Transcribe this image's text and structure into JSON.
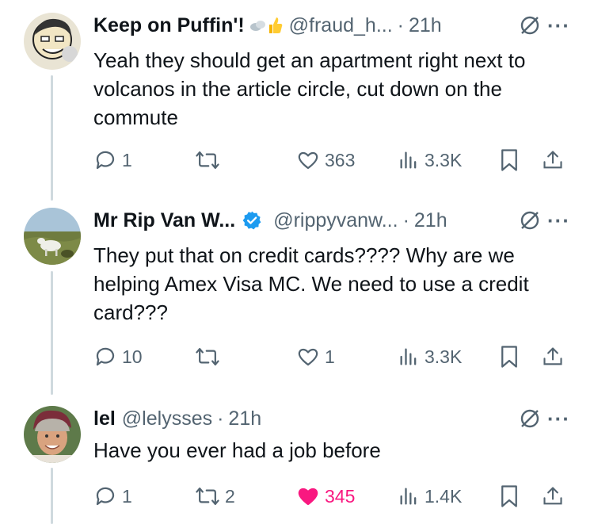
{
  "tweets": [
    {
      "name": "Keep on Puffin'!",
      "handle": "@fraud_h...",
      "time": "21h",
      "text": "Yeah they should get an apartment right next to volcanos in the article circle, cut down on the commute",
      "replies": "1",
      "reposts": "",
      "likes": "363",
      "views": "3.3K",
      "liked": false,
      "avatar_icon": "cartoon-face-avatar",
      "badges": [
        "cloud-emoji",
        "thumbs-up-emoji"
      ]
    },
    {
      "name": "Mr Rip Van W...",
      "handle": "@rippyvanw...",
      "time": "21h",
      "text": "They put that on credit cards???? Why are we helping Amex Visa MC. We need to use a credit card???",
      "replies": "10",
      "reposts": "",
      "likes": "1",
      "views": "3.3K",
      "liked": false,
      "avatar_icon": "goat-field-avatar",
      "badges": [
        "verified-badge"
      ]
    },
    {
      "name": "lel",
      "handle": "@lelysses",
      "time": "21h",
      "text": "Have you ever had a job before",
      "replies": "1",
      "reposts": "2",
      "likes": "345",
      "views": "1.4K",
      "liked": true,
      "avatar_icon": "man-photo-avatar",
      "badges": []
    }
  ],
  "colors": {
    "like_active": "#f91880",
    "muted": "#536471",
    "verified": "#1d9bf0"
  }
}
